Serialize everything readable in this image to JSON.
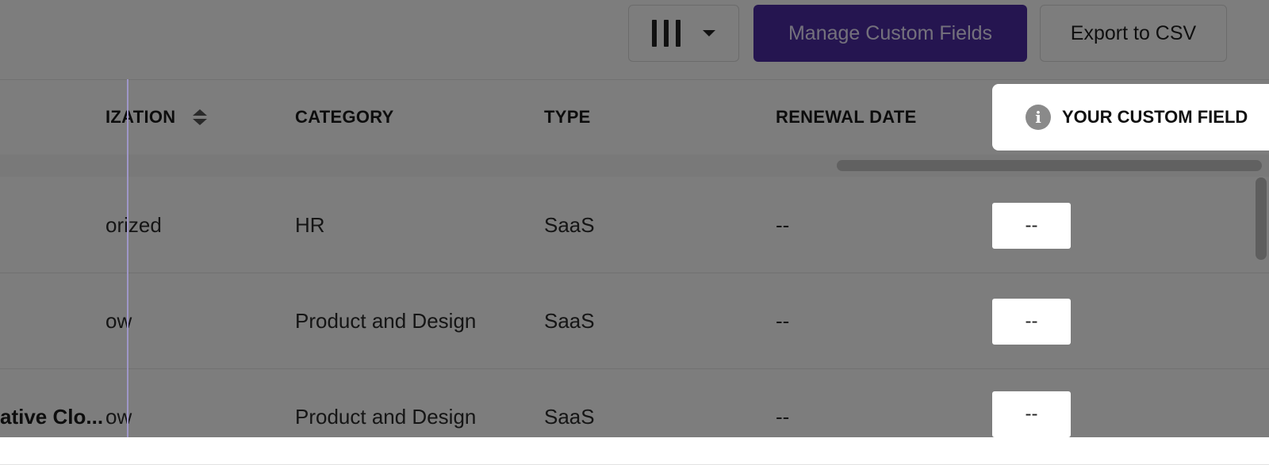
{
  "toolbar": {
    "columns_icon": "columns-icon",
    "manage_label": "Manage Custom Fields",
    "export_label": "Export to CSV",
    "accent": "#4b2aa0"
  },
  "table": {
    "headers": {
      "organization": "IZATION",
      "category": "CATEGORY",
      "type": "TYPE",
      "renewal": "RENEWAL DATE",
      "custom": "YOUR CUSTOM FIELD"
    },
    "rows": [
      {
        "name": "",
        "organization": "orized",
        "category": "HR",
        "type": "SaaS",
        "renewal": "--",
        "custom": "--"
      },
      {
        "name": "",
        "organization": "ow",
        "category": "Product and Design",
        "type": "SaaS",
        "renewal": "--",
        "custom": "--"
      },
      {
        "name": "ative Clo...",
        "organization": "ow",
        "category": "Product and Design",
        "type": "SaaS",
        "renewal": "--",
        "custom": "--"
      }
    ]
  }
}
